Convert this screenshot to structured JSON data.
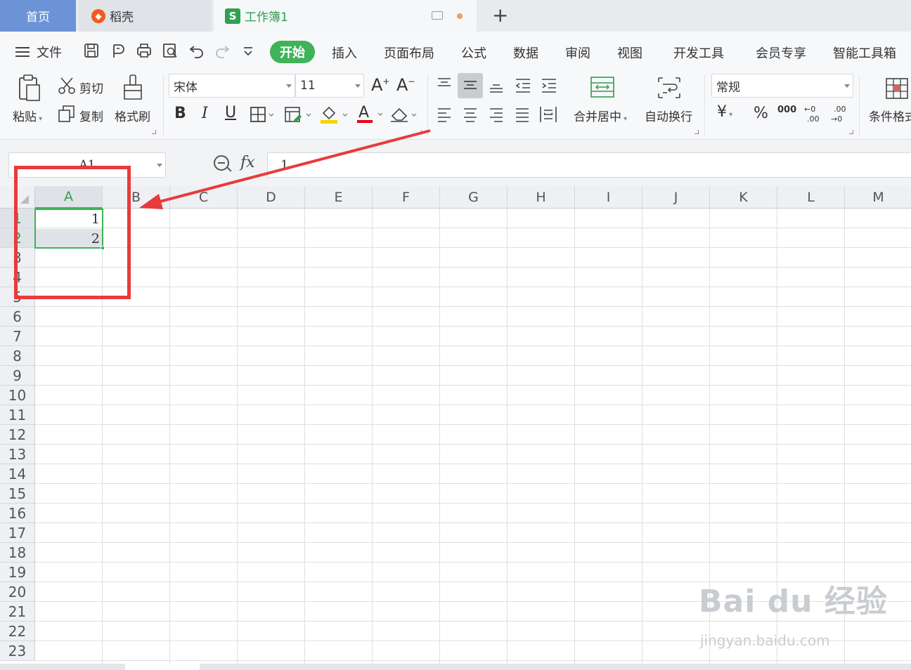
{
  "tabs": {
    "home": "首页",
    "daoke": "稻壳",
    "workbook": "工作簿1",
    "new_tab": "+"
  },
  "menu": {
    "file": "文件",
    "items": [
      "开始",
      "插入",
      "页面布局",
      "公式",
      "数据",
      "审阅",
      "视图",
      "开发工具",
      "会员专享",
      "智能工具箱"
    ]
  },
  "ribbon": {
    "paste": "粘贴",
    "cut": "剪切",
    "copy": "复制",
    "format_painter": "格式刷",
    "font_name": "宋体",
    "font_size": "11",
    "bold": "B",
    "italic": "I",
    "underline": "U",
    "merge_center": "合并居中",
    "wrap_text": "自动换行",
    "number_format": "常规",
    "currency": "¥",
    "percent": "%",
    "thousands": "000",
    "cond_format": "条件格式"
  },
  "formula_bar": {
    "name_box": "A1",
    "fx": "fx",
    "value": "1"
  },
  "grid": {
    "columns": [
      "A",
      "B",
      "C",
      "D",
      "E",
      "F",
      "G",
      "H",
      "I",
      "J",
      "K",
      "L",
      "M"
    ],
    "rows": [
      "1",
      "2",
      "3",
      "4",
      "5",
      "6",
      "7",
      "8",
      "9",
      "10",
      "11",
      "12",
      "13",
      "14",
      "15",
      "16",
      "17",
      "18",
      "19",
      "20",
      "21",
      "22",
      "23"
    ],
    "cells": {
      "A1": "1",
      "A2": "2"
    }
  },
  "watermark": {
    "brand": "Bai du 经验",
    "url": "jingyan.baidu.com"
  },
  "colors": {
    "accent": "#3fb357",
    "annotation": "#e83b3b",
    "home_tab": "#6c93d6"
  }
}
